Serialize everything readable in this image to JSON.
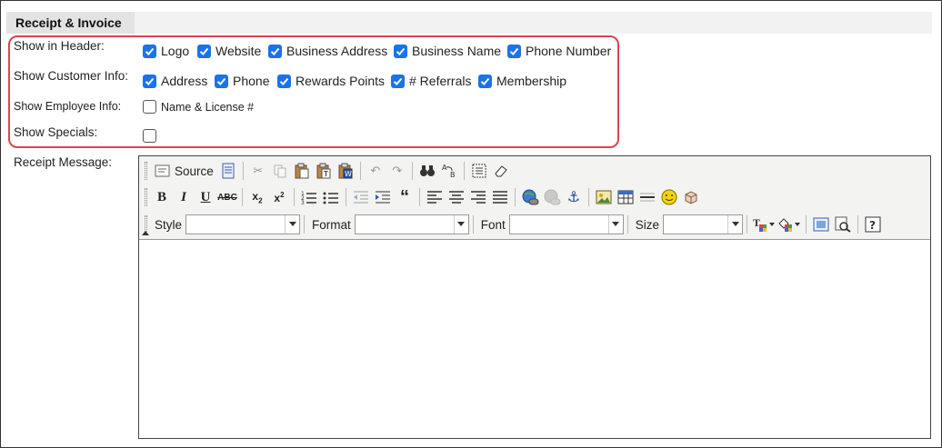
{
  "section": {
    "title": "Receipt & Invoice"
  },
  "header_row": {
    "label": "Show in Header:",
    "options": [
      {
        "label": "Logo",
        "checked": true
      },
      {
        "label": "Website",
        "checked": true
      },
      {
        "label": "Business Address",
        "checked": true
      },
      {
        "label": "Business Name",
        "checked": true
      },
      {
        "label": "Phone Number",
        "checked": true
      }
    ]
  },
  "customer_row": {
    "label": "Show Customer Info:",
    "options": [
      {
        "label": "Address",
        "checked": true
      },
      {
        "label": "Phone",
        "checked": true
      },
      {
        "label": "Rewards Points",
        "checked": true
      },
      {
        "label": "# Referrals",
        "checked": true
      },
      {
        "label": "Membership",
        "checked": true
      }
    ]
  },
  "employee_row": {
    "label": "Show Employee Info:",
    "options": [
      {
        "label": "Name & License #",
        "checked": false
      }
    ]
  },
  "specials_row": {
    "label": "Show Specials:",
    "checked": false
  },
  "receipt_message": {
    "label": "Receipt Message:",
    "toolbar": {
      "source_label": "Source",
      "style_label": "Style",
      "format_label": "Format",
      "font_label": "Font",
      "size_label": "Size",
      "style_value": "",
      "format_value": "",
      "font_value": "",
      "size_value": ""
    },
    "content": ""
  },
  "colors": {
    "highlight": "#e0414f",
    "checkbox": "#1a73e8"
  }
}
